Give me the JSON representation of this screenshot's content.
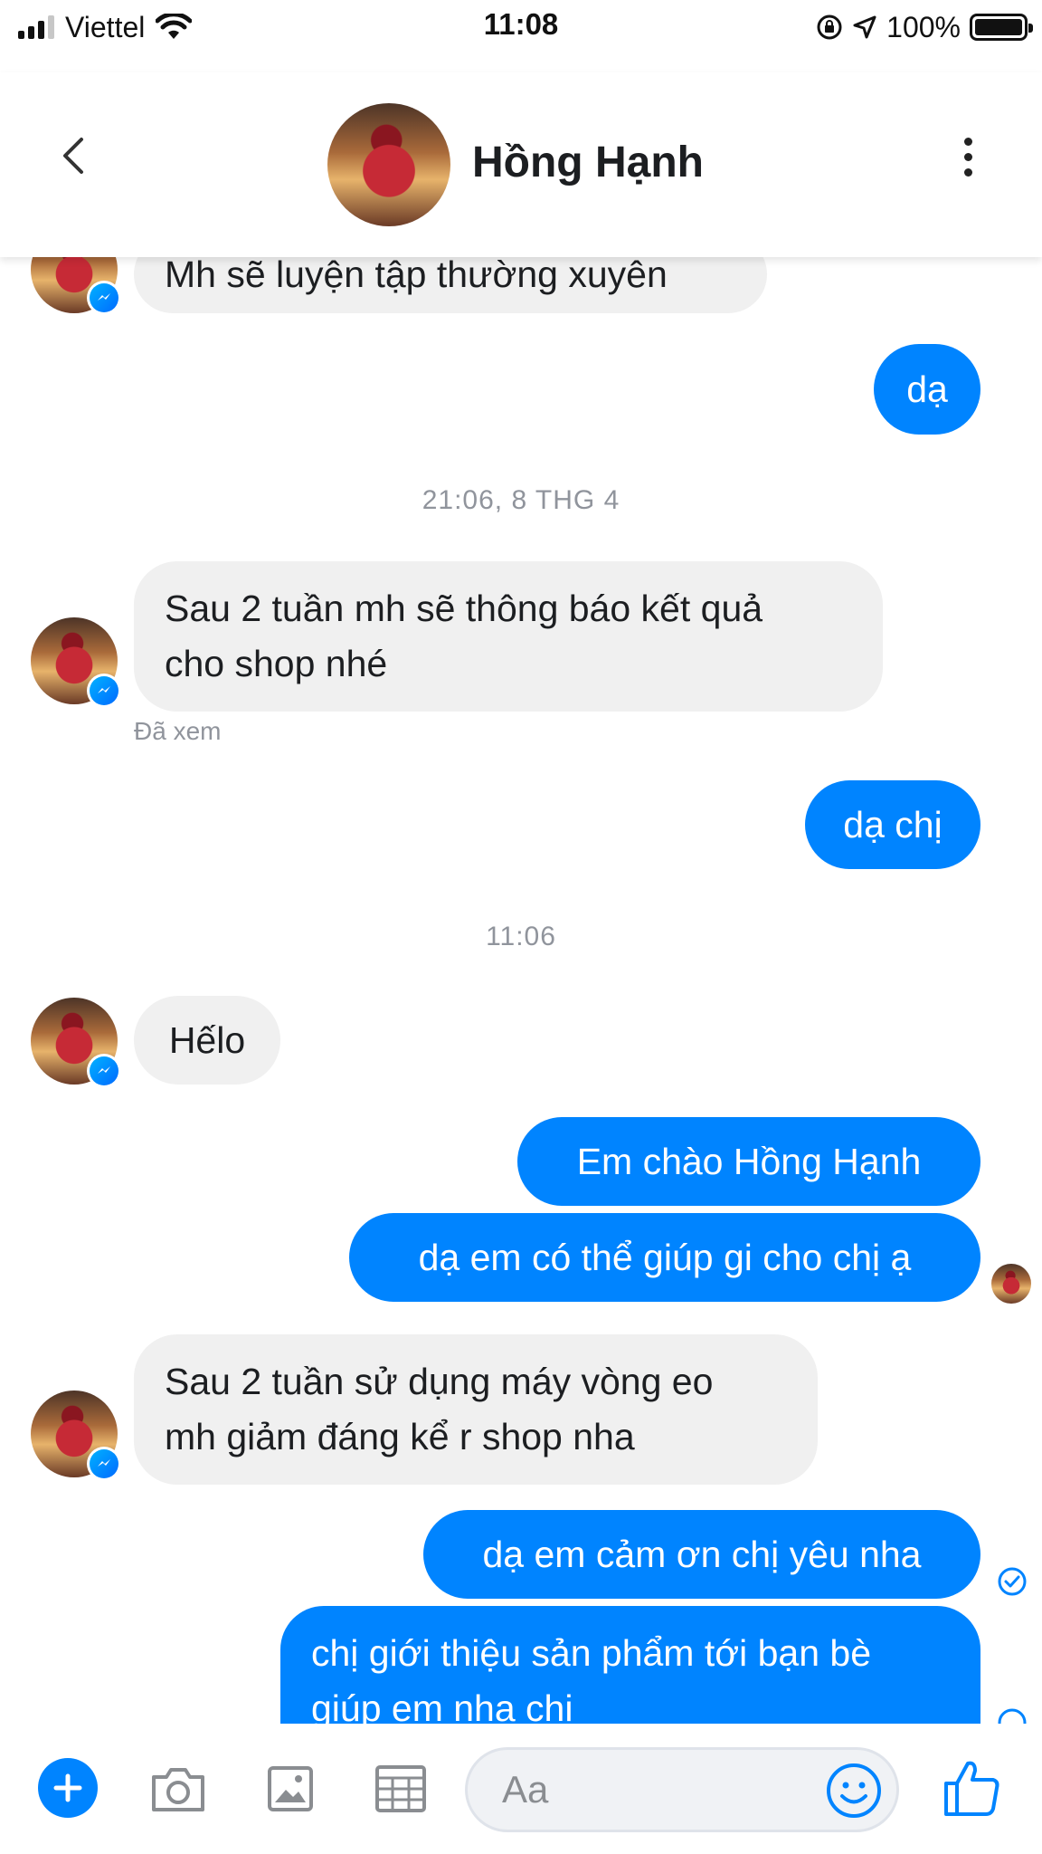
{
  "status_bar": {
    "carrier": "Viettel",
    "time": "11:08",
    "battery": "100%",
    "battery_level": 1.0,
    "icons": [
      "signal-icon",
      "wifi-icon",
      "rotation-lock-icon",
      "location-arrow-icon",
      "battery-icon"
    ]
  },
  "header": {
    "contact_name": "Hồng Hạnh",
    "icons": [
      "back-chevron-icon",
      "more-vertical-icon"
    ]
  },
  "messages": {
    "m1": "Mh sẽ luyện tập thường xuyên",
    "m2": "dạ",
    "ts1": "21:06, 8 THG 4",
    "m3_line1": "Sau 2 tuần mh sẽ thông báo kết quả",
    "m3_line2": "cho shop nhé",
    "seen": "Đã xem",
    "m4": "dạ chị",
    "ts2": "11:06",
    "m5": "Hếlo",
    "m6": "Em chào  Hồng Hạnh",
    "m7": "dạ em có thể giúp gi cho chị ạ",
    "m8_line1": "Sau 2 tuần sử dụng máy vòng eo",
    "m8_line2": "mh giảm đáng kể r shop nha",
    "m9": "dạ em cảm ơn chị yêu nha",
    "m10_line1": "chị giới thiệu sản phẩm tới bạn bè",
    "m10_line2": "giúp em nha chị"
  },
  "composer": {
    "placeholder": "Aa",
    "icons": [
      "plus-icon",
      "camera-icon",
      "image-icon",
      "table-icon",
      "emoji-icon",
      "thumbs-up-icon"
    ]
  },
  "colors": {
    "outgoing_bubble": "#0084ff",
    "incoming_bubble": "#f0f0f0",
    "messenger_blue": "#0084ff",
    "meta_text": "#90949c"
  }
}
